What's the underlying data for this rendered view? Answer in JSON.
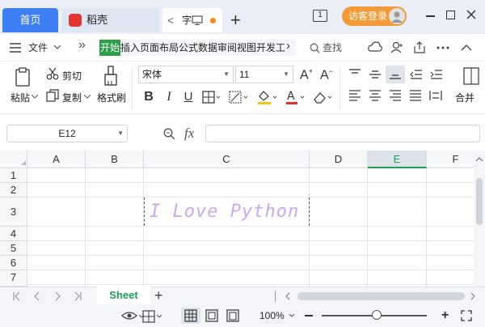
{
  "titlebar": {
    "home_tab": "首页",
    "doc_tab": "稻壳",
    "current_tab_prefix": "<",
    "current_tab_label": "字",
    "new_tab": "+",
    "visitor_login": "访客登录",
    "page_indicator": "1"
  },
  "menubar": {
    "file": "文件",
    "more": "»",
    "ribbon_active": "开始",
    "ribbon_rest": "插入页面布局公式数据审阅视图开发工",
    "ribbon_next": "›",
    "search": "查找"
  },
  "toolbar": {
    "paste": "粘贴",
    "cut": "剪切",
    "copy": "复制",
    "format_painter": "格式刷",
    "font_name": "宋体",
    "font_size": "11",
    "bold": "B",
    "italic": "I",
    "underline": "U",
    "merge": "合并"
  },
  "formula": {
    "name_box": "E12",
    "fx": "fx",
    "value": ""
  },
  "grid": {
    "columns": [
      "A",
      "B",
      "C",
      "D",
      "E",
      "F"
    ],
    "selected_column": "E",
    "rows": [
      "1",
      "2",
      "3",
      "4",
      "5",
      "6",
      "7"
    ],
    "cell_c3": "I Love Python"
  },
  "sheets": {
    "active": "Sheet",
    "add": "+"
  },
  "status": {
    "zoom": "100%",
    "zoom_fraction": 0.52
  },
  "colors": {
    "accent": "#3f7ff6",
    "ribbon_active": "#2e9e4a",
    "sheet_active": "#1f9d55",
    "visitor_button": "#f29b38",
    "cell_text": "#c9a8f0"
  }
}
